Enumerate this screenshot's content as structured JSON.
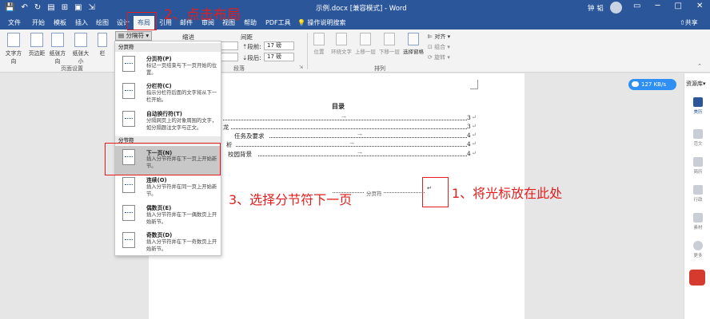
{
  "titlebar": {
    "quick_access": [
      "💾",
      "↶",
      "↻",
      "▤",
      "⊞",
      "▣",
      "⇲"
    ],
    "document_title": "示例.docx [兼容模式] - Word",
    "user": "钟 韬",
    "window_buttons": [
      "▭",
      "─",
      "□",
      "✕"
    ]
  },
  "tabs": [
    "文件",
    "开始",
    "模板",
    "插入",
    "绘图",
    "设计",
    "布局",
    "引用",
    "邮件",
    "审阅",
    "视图",
    "帮助",
    "PDF工具"
  ],
  "tell_me": "操作说明搜索",
  "share_label": "共享",
  "ribbon": {
    "page_setup_buttons": [
      "文字方向",
      "页边距",
      "纸张方向",
      "纸张大小",
      "栏"
    ],
    "page_setup_label": "页面设置",
    "breaks_label": "分隔符",
    "indent_label": "缩进",
    "spacing_label": "间距",
    "spacing_before_label": "段前:",
    "spacing_after_label": "段后:",
    "spacing_before": "17 磅",
    "spacing_after": "17 磅",
    "paragraph_label": "段落",
    "arrange_buttons": [
      "位置",
      "环绕文字",
      "上移一层",
      "下移一层",
      "选择窗格"
    ],
    "align_label": "对齐",
    "group_label": "组合",
    "rotate_label": "旋转",
    "arrange_label": "排列"
  },
  "breaks_menu": {
    "page_breaks_header": "分页符",
    "section_breaks_header": "分节符",
    "items": [
      {
        "name": "分页符(P)",
        "desc": "标记一页结束与下一页开始的位置。"
      },
      {
        "name": "分栏符(C)",
        "desc": "指示分栏符后面的文字将从下一栏开始。"
      },
      {
        "name": "自动换行符(T)",
        "desc": "分隔网页上的对象周围的文字，如分隔题注文字与正文。"
      },
      {
        "name": "下一页(N)",
        "desc": "插入分节符并在下一页上开始新节。"
      },
      {
        "name": "连续(O)",
        "desc": "插入分节符并在同一页上开始新节。"
      },
      {
        "name": "偶数页(E)",
        "desc": "插入分节符并在下一偶数页上开始新节。"
      },
      {
        "name": "奇数页(D)",
        "desc": "插入分节符并在下一奇数页上开始新节。"
      }
    ]
  },
  "document": {
    "toc_title": "目录",
    "toc_entries": [
      {
        "text": "",
        "page": "3"
      },
      {
        "text": "龙",
        "page": "3"
      },
      {
        "text": "任务及要求",
        "page": "4"
      },
      {
        "text": "析",
        "page": "4"
      },
      {
        "text": "校园背景",
        "page": "4"
      }
    ],
    "section_break_text": "分页符",
    "pilcrow": "↵",
    "arrow": "→"
  },
  "speed": "127 KB/s",
  "right_panel": {
    "header": "资源库",
    "items": [
      "美历",
      "范文",
      "简历",
      "行政",
      "素材",
      "更多"
    ]
  },
  "annotations": {
    "step1": "1、将光标放在此处",
    "step2": "2、点击布局",
    "step3": "3、选择分节符下一页"
  },
  "colors": {
    "word_blue": "#2b579a",
    "annotation_red": "#e31d1d"
  }
}
